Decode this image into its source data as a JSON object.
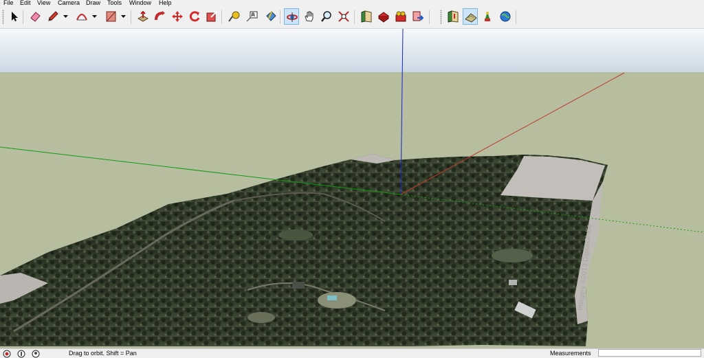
{
  "menu": [
    "File",
    "Edit",
    "View",
    "Camera",
    "Draw",
    "Tools",
    "Window",
    "Help"
  ],
  "toolbar": {
    "icons": [
      "select-icon",
      "eraser-icon",
      "pencil-icon",
      "arc-icon",
      "rectangle-icon",
      "push-pull-icon",
      "follow-me-icon",
      "move-icon",
      "rotate-icon",
      "scale-icon",
      "tape-measure-icon",
      "text-icon",
      "paint-bucket-icon",
      "orbit-icon",
      "pan-icon",
      "zoom-icon",
      "zoom-extents-icon",
      "3d-warehouse-icon",
      "share-model-icon",
      "get-models-icon",
      "send-to-layout-icon",
      "add-location-icon",
      "toggle-terrain-icon",
      "photo-textures-icon",
      "preview-in-google-earth-icon"
    ],
    "active": "orbit-icon"
  },
  "scene": {
    "sky_color": "#dfe9f1",
    "ground_color": "#b7bea0",
    "terrain_color": "#2e3826",
    "axis_colors": {
      "red": "#c0392b",
      "green": "#109a10",
      "blue": "#1822c8"
    },
    "watermark": "Imagery ©2013 DigitalGlobe"
  },
  "status": {
    "icons": [
      "credits-icon",
      "info-icon",
      "user-icon"
    ],
    "text": "Drag to orbit.  Shift = Pan",
    "measurements_label": "Measurements",
    "measurements_value": ""
  }
}
